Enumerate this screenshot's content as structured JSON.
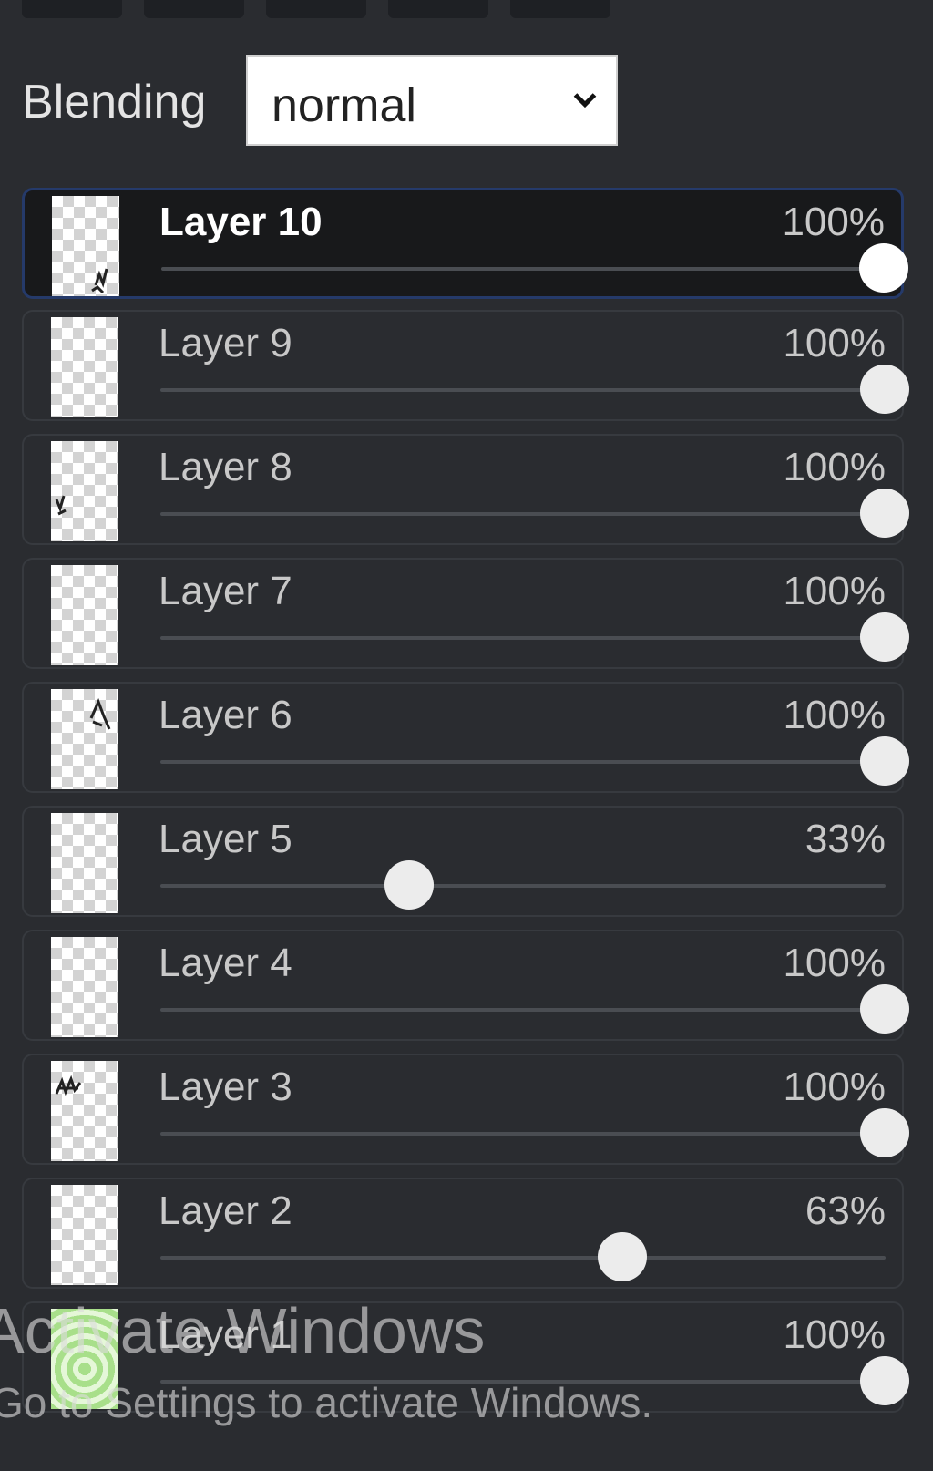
{
  "blending": {
    "label": "Blending",
    "value": "normal",
    "chevron_icon": "chevron-down-icon"
  },
  "layers": [
    {
      "name": "Layer 10",
      "opacity": "100%",
      "opacity_value": 100,
      "selected": true
    },
    {
      "name": "Layer 9",
      "opacity": "100%",
      "opacity_value": 100
    },
    {
      "name": "Layer 8",
      "opacity": "100%",
      "opacity_value": 100
    },
    {
      "name": "Layer 7",
      "opacity": "100%",
      "opacity_value": 100
    },
    {
      "name": "Layer 6",
      "opacity": "100%",
      "opacity_value": 100
    },
    {
      "name": "Layer 5",
      "opacity": "33%",
      "opacity_value": 33
    },
    {
      "name": "Layer 4",
      "opacity": "100%",
      "opacity_value": 100
    },
    {
      "name": "Layer 3",
      "opacity": "100%",
      "opacity_value": 100
    },
    {
      "name": "Layer 2",
      "opacity": "63%",
      "opacity_value": 63
    },
    {
      "name": "Layer 1",
      "opacity": "100%",
      "opacity_value": 100
    }
  ],
  "watermark": {
    "title": "Activate Windows",
    "subtitle": "Go to Settings to activate Windows."
  }
}
